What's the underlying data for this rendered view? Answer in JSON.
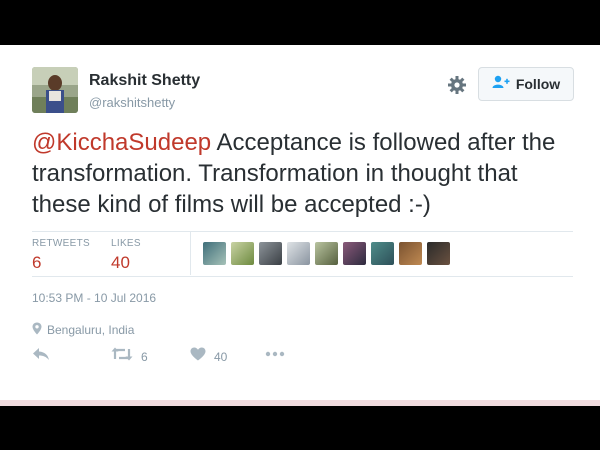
{
  "user": {
    "name": "Rakshit Shetty",
    "handle": "@rakshitshetty"
  },
  "follow_label": "Follow",
  "tweet": {
    "mention": "@KicchaSudeep",
    "text": " Acceptance is followed after the transformation. Transformation in thought that these kind of films will be accepted :-)"
  },
  "stats": {
    "retweets_label": "RETWEETS",
    "retweets_count": "6",
    "likes_label": "LIKES",
    "likes_count": "40"
  },
  "timestamp": "10:53 PM - 10 Jul 2016",
  "location": "Bengaluru, India",
  "actions": {
    "retweet_count": "6",
    "like_count": "40"
  },
  "icons": [
    "gear-icon",
    "follow-person-icon",
    "location-pin-icon",
    "reply-icon",
    "retweet-icon",
    "heart-icon",
    "more-icon"
  ],
  "colors": {
    "mention": "#c0392b",
    "stat_number": "#c0392b",
    "muted": "#8899a6",
    "text": "#292f33",
    "follow_icon": "#1da1f2"
  }
}
